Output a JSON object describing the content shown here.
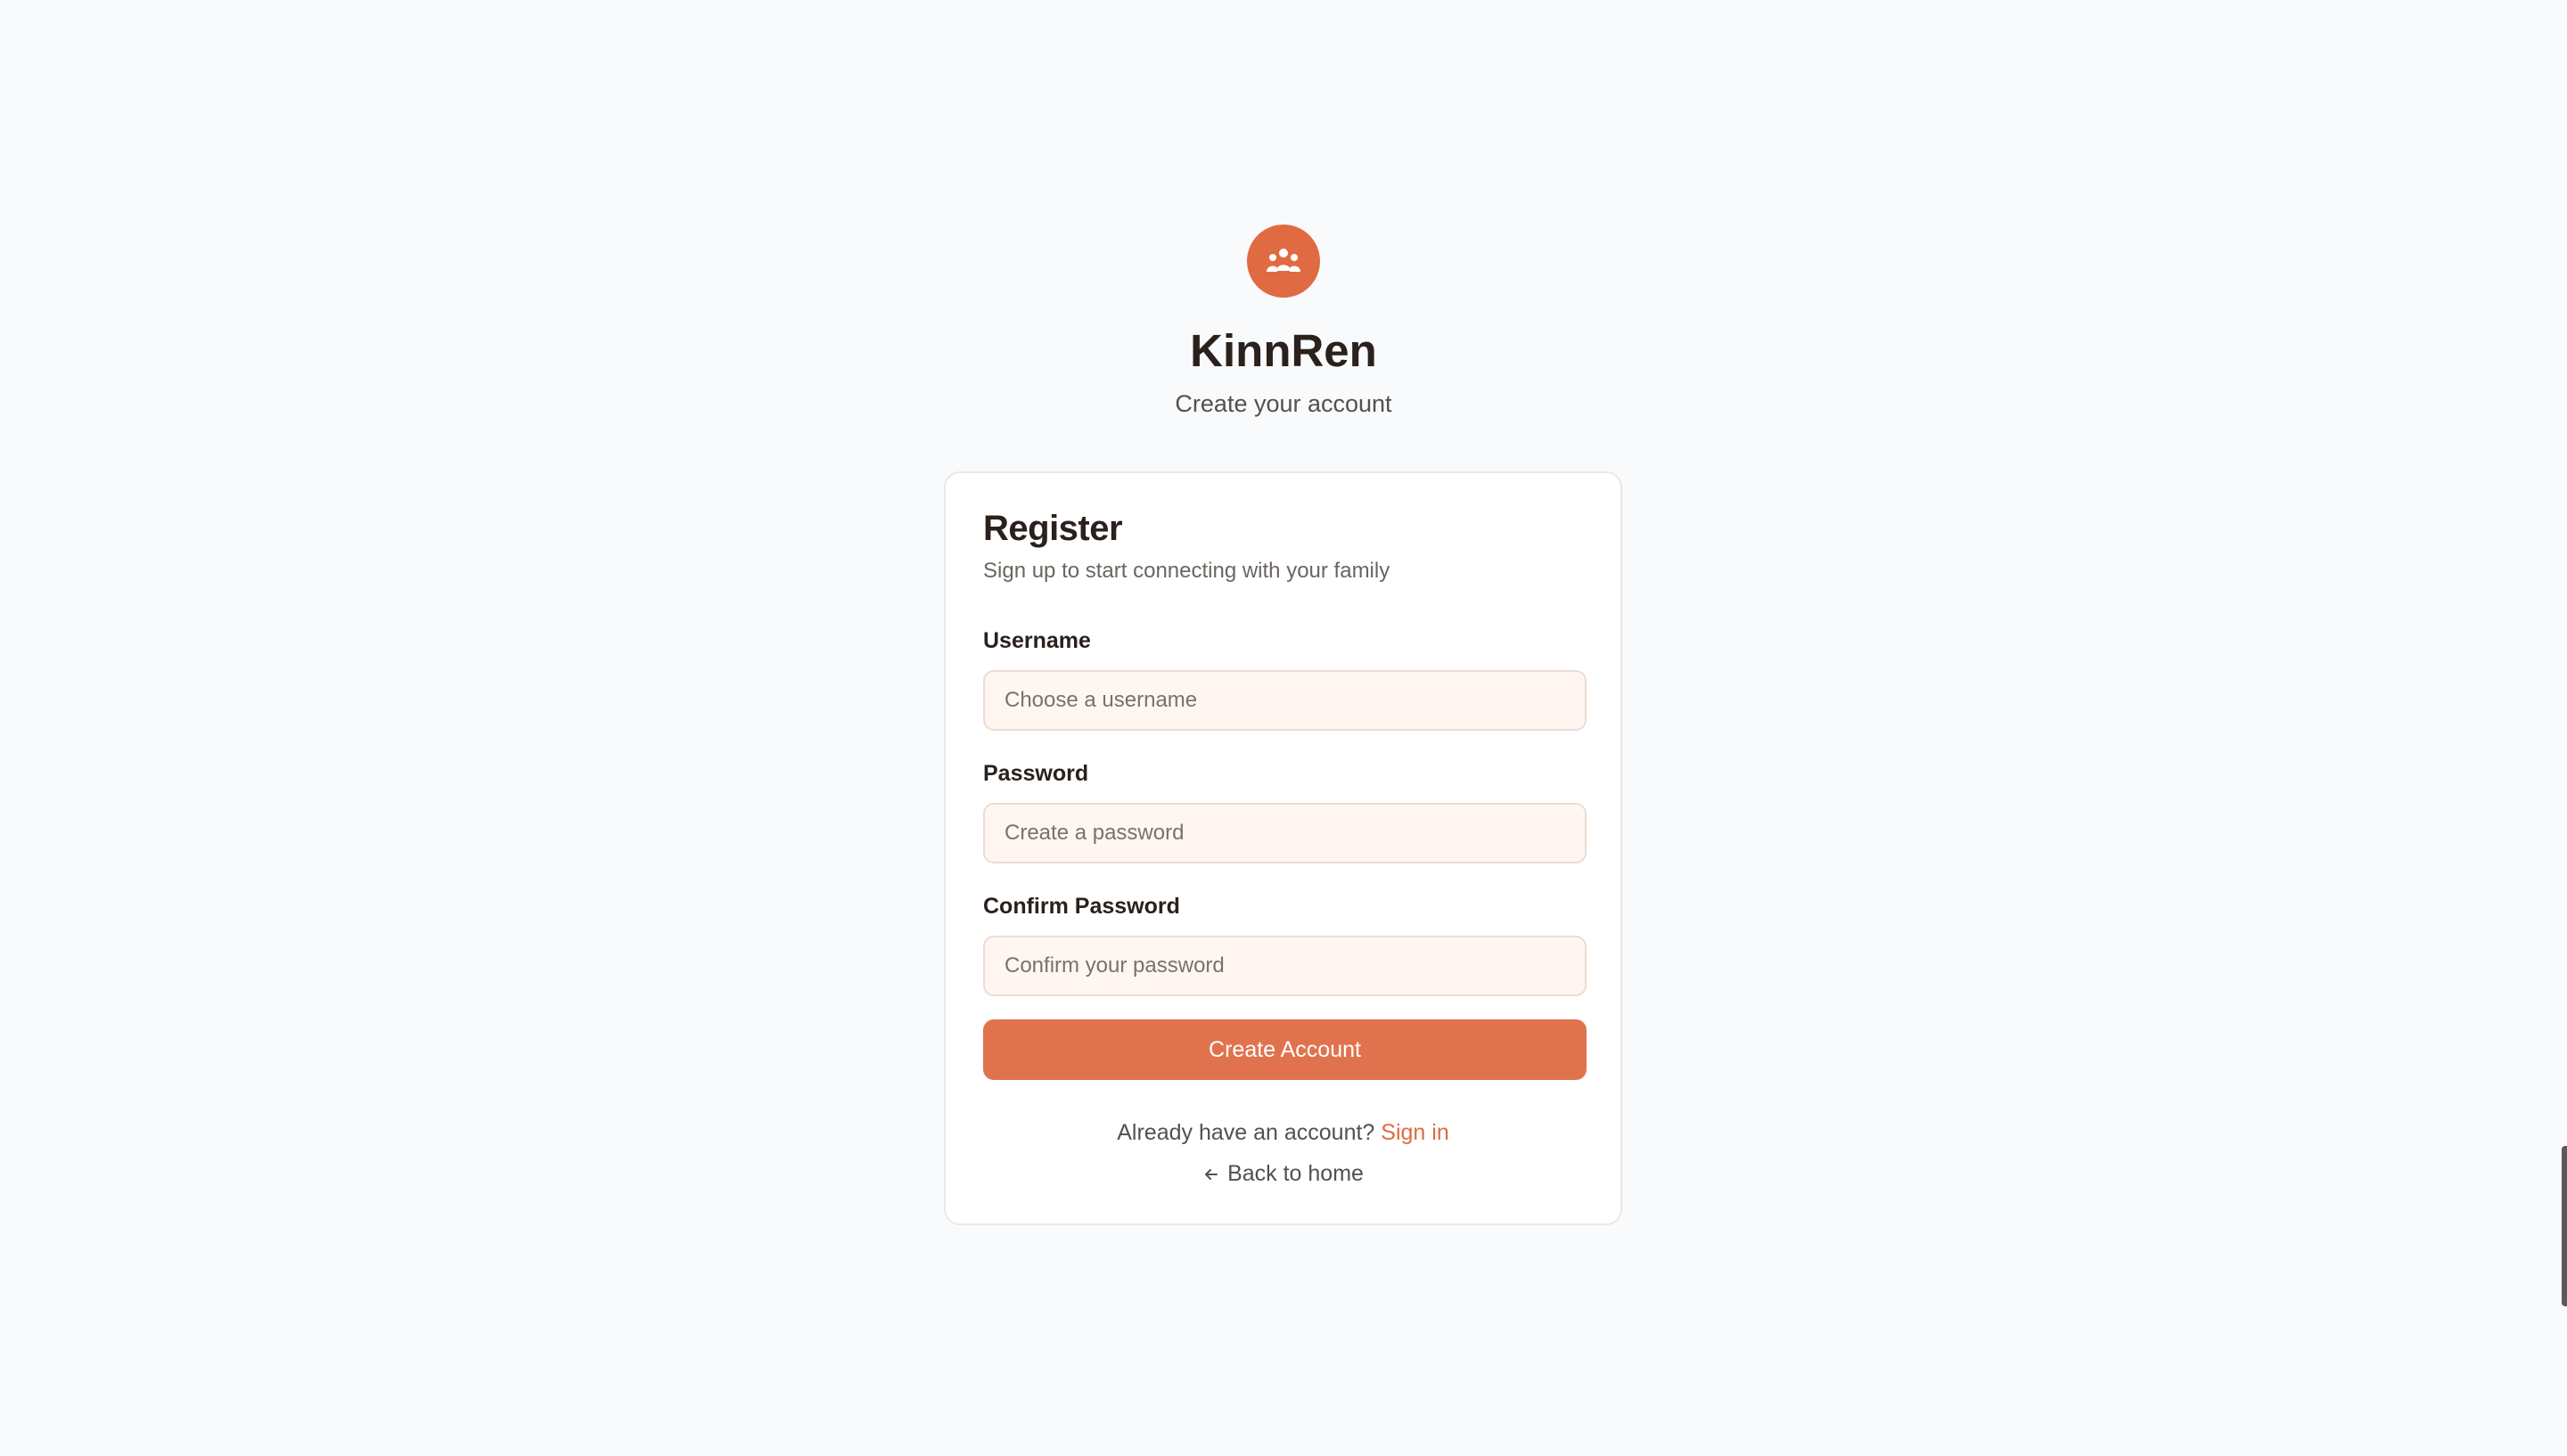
{
  "brand": {
    "logo_icon": "family-group-icon",
    "title": "KinnRen",
    "subtitle": "Create your account",
    "accent_color": "#e06a42"
  },
  "register": {
    "title": "Register",
    "subtitle": "Sign up to start connecting with your family",
    "fields": {
      "username": {
        "label": "Username",
        "value": "",
        "placeholder": "Choose a username"
      },
      "password": {
        "label": "Password",
        "value": "",
        "placeholder": "Create a password"
      },
      "confirm_password": {
        "label": "Confirm Password",
        "value": "",
        "placeholder": "Confirm your password"
      }
    },
    "submit_label": "Create Account",
    "signin_prompt": "Already have an account?",
    "signin_link": "Sign in",
    "back_icon": "arrow-left-icon",
    "back_link": "Back to home"
  }
}
